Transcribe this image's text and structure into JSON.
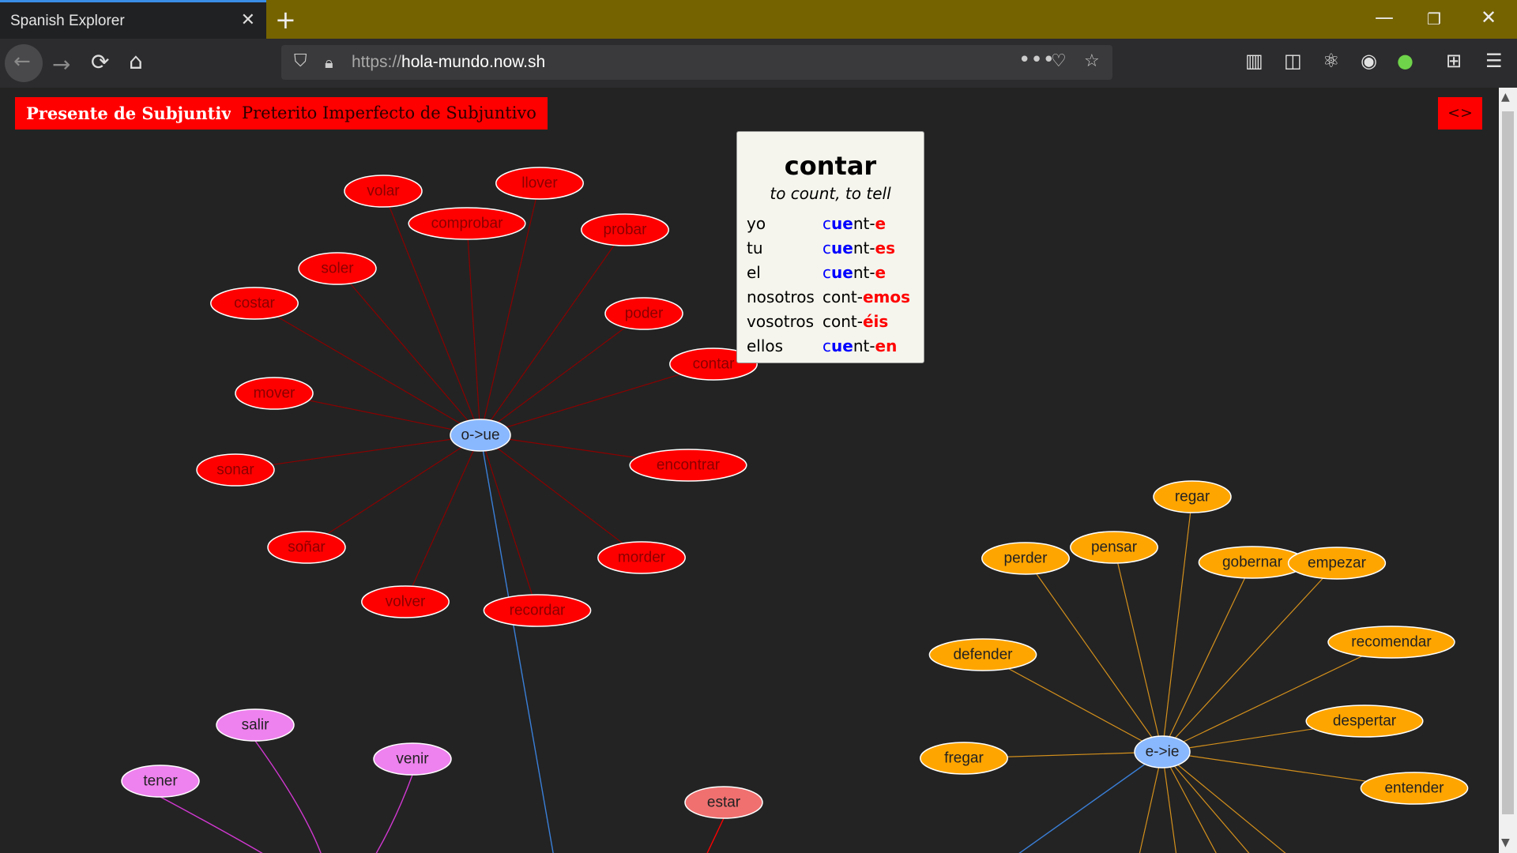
{
  "browser": {
    "tab_title": "Spanish Explorer",
    "url_protocol": "https://",
    "url_host": "hola-mundo.now.sh",
    "tab_close_icon": "close-icon",
    "new_tab_label": "+"
  },
  "tense_tabs": [
    {
      "label": "Presente de Subjuntivo",
      "active": true
    },
    {
      "label": "Preterito Imperfecto de Subjuntivo",
      "active": false
    }
  ],
  "toggle_label": "<>",
  "colors": {
    "red_node": "#ff0000",
    "red_edge": "#8b0000",
    "orange_node": "#ffa500",
    "orange_edge": "#d4901c",
    "violet_node": "#ee82ee",
    "violet_edge": "#d238d2",
    "hub": "#8ab8ff",
    "cross_edge": "#3a7fd8",
    "estar_node": "#f07070"
  },
  "graph": {
    "hubs": [
      "o->ue",
      "e->ie"
    ],
    "o_ue_verbs": [
      "volar",
      "llover",
      "comprobar",
      "probar",
      "soler",
      "costar",
      "poder",
      "contar",
      "mover",
      "encontrar",
      "sonar",
      "soñar",
      "morder",
      "volver",
      "recordar"
    ],
    "e_ie_verbs": [
      "regar",
      "perder",
      "pensar",
      "gobernar",
      "empezar",
      "recomendar",
      "defender",
      "despertar",
      "fregar",
      "entender"
    ],
    "irregular_verbs": [
      "salir",
      "tener",
      "venir"
    ],
    "other_verbs": [
      "estar"
    ]
  },
  "card": {
    "verb": "contar",
    "translation": "to count, to tell",
    "rows": [
      {
        "pronoun": "yo",
        "stem_a": "c",
        "stem_b": "ue",
        "stem_c": "nt-",
        "ending": "e"
      },
      {
        "pronoun": "tu",
        "stem_a": "c",
        "stem_b": "ue",
        "stem_c": "nt-",
        "ending": "es"
      },
      {
        "pronoun": "el",
        "stem_a": "c",
        "stem_b": "ue",
        "stem_c": "nt-",
        "ending": "e"
      },
      {
        "pronoun": "nosotros",
        "stem_a": "cont-",
        "stem_b": "",
        "stem_c": "",
        "ending": "emos"
      },
      {
        "pronoun": "vosotros",
        "stem_a": "cont-",
        "stem_b": "",
        "stem_c": "",
        "ending": "éis"
      },
      {
        "pronoun": "ellos",
        "stem_a": "c",
        "stem_b": "ue",
        "stem_c": "nt-",
        "ending": "en"
      }
    ]
  }
}
